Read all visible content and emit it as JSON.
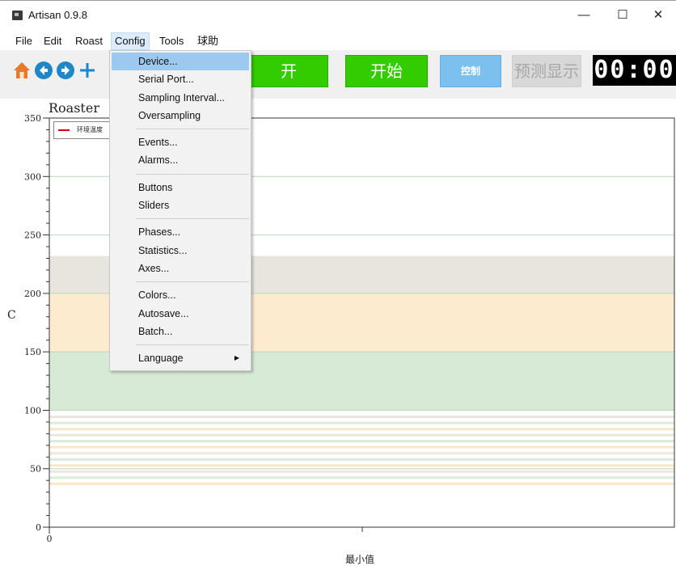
{
  "window": {
    "title": "Artisan 0.9.8",
    "minimize": "—",
    "maximize": "☐",
    "close": "✕"
  },
  "menubar": [
    "File",
    "Edit",
    "Roast",
    "Config",
    "Tools",
    "球助"
  ],
  "toolbar": {
    "icons": [
      "home-icon",
      "back-arrow-icon",
      "forward-arrow-icon",
      "move-icon"
    ],
    "buttons": {
      "on": "开",
      "start": "开始",
      "control": "控制",
      "predict": "预测显示"
    },
    "timer": "00:00",
    "colors": {
      "green": "#33cc00",
      "control": "#7cc0f0",
      "predict": "#d8d8d8"
    }
  },
  "config_menu": {
    "groups": [
      [
        "Device...",
        "Serial Port...",
        "Sampling Interval...",
        "Oversampling"
      ],
      [
        "Events...",
        "Alarms..."
      ],
      [
        "Buttons",
        "Sliders"
      ],
      [
        "Phases...",
        "Statistics...",
        "Axes..."
      ],
      [
        "Colors...",
        "Autosave...",
        "Batch..."
      ],
      [
        "Language"
      ]
    ],
    "highlighted": "Device...",
    "submenu_arrow": "▶"
  },
  "chart": {
    "title": "Roaster",
    "y_unit": "C",
    "x_label": "最小值",
    "x_ticks": [
      "0"
    ],
    "y_ticks": [
      "0",
      "50",
      "100",
      "150",
      "200",
      "250",
      "300",
      "350"
    ],
    "legend": "环境温度",
    "bands": [
      {
        "from": 150,
        "to": 200,
        "color": "#fdebd0"
      },
      {
        "from": 100,
        "to": 150,
        "color": "#d6ead6"
      },
      {
        "from": 200,
        "to": 232,
        "color": "#e8e4de"
      }
    ]
  },
  "chart_data": {
    "type": "line",
    "title": "Roaster",
    "ylabel": "C",
    "xlabel": "最小值",
    "ylim": [
      0,
      350
    ],
    "series": [
      {
        "name": "环境温度",
        "values": []
      }
    ],
    "grid": true,
    "legend_position": "top-left"
  }
}
